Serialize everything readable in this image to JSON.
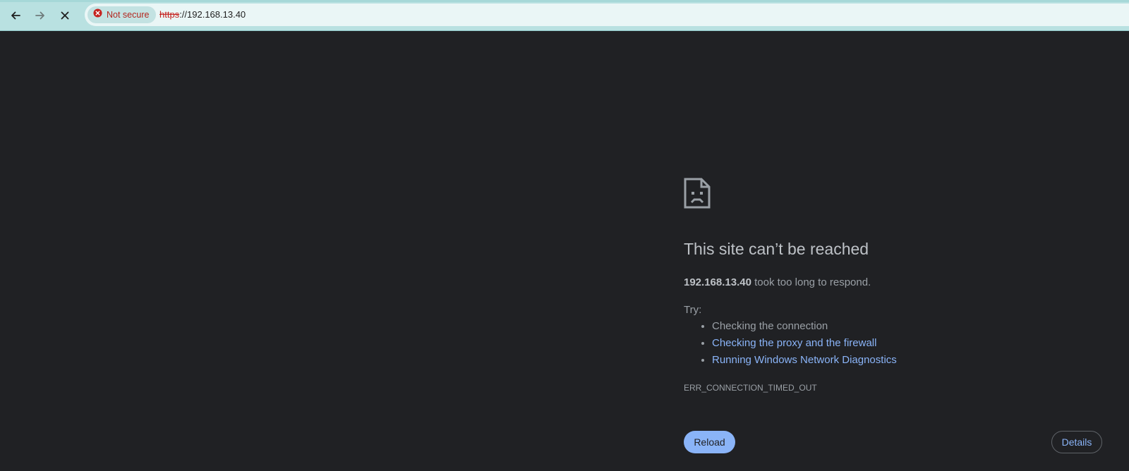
{
  "toolbar": {
    "back_icon": "arrow-left-icon",
    "forward_icon": "arrow-right-icon",
    "stop_icon": "close-icon",
    "security_icon": "error-circle-icon",
    "security_label": "Not secure",
    "url_scheme": "https",
    "url_rest": "://192.168.13.40",
    "accent_color": "#b9e1e1"
  },
  "error_page": {
    "icon": "sad-page-icon",
    "title": "This site can’t be reached",
    "host": "192.168.13.40",
    "description": "took too long to respond.",
    "try_label": "Try:",
    "suggestions": [
      {
        "text": "Checking the connection",
        "is_link": false
      },
      {
        "text": "Checking the proxy and the firewall",
        "is_link": true
      },
      {
        "text": "Running Windows Network Diagnostics",
        "is_link": true
      }
    ],
    "error_code": "ERR_CONNECTION_TIMED_OUT",
    "reload_label": "Reload",
    "details_label": "Details",
    "link_color": "#8ab4f8",
    "background_color": "#202124"
  }
}
